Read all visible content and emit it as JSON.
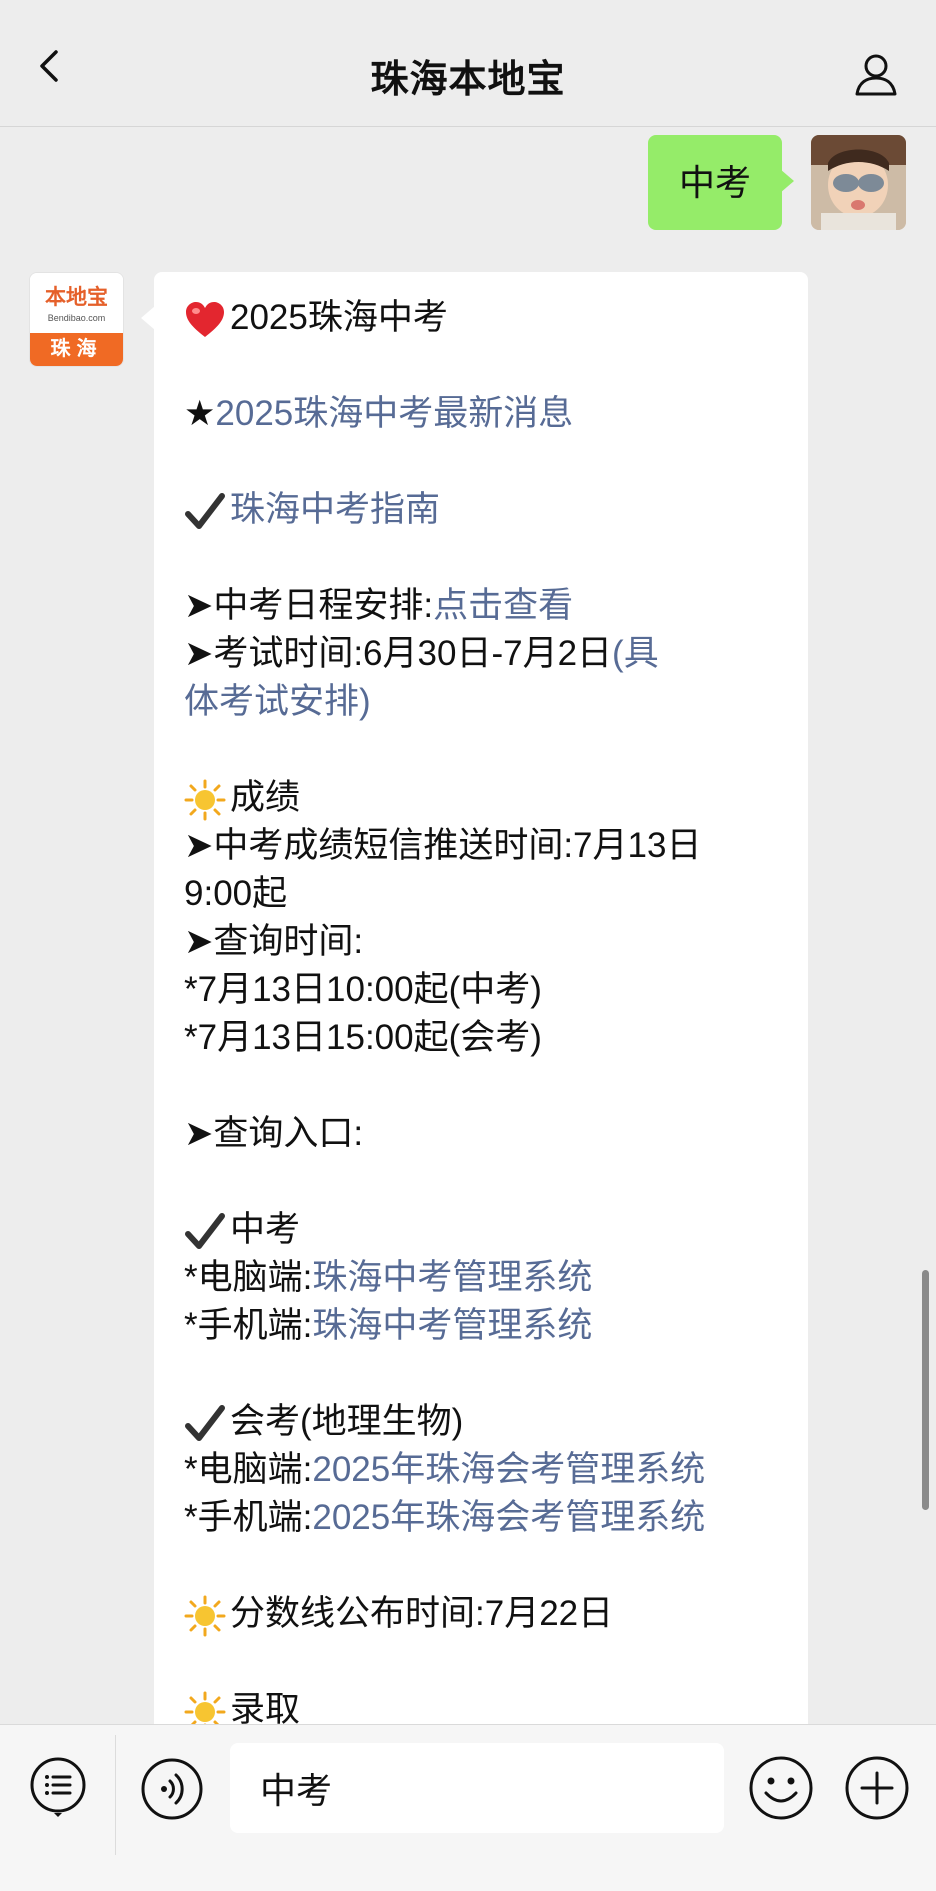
{
  "header": {
    "title": "珠海本地宝"
  },
  "user_message": {
    "text": "中考"
  },
  "bot_avatar": {
    "logo": "本地宝",
    "logo_sub": "Bendibao.com",
    "city": "珠海"
  },
  "bot_message": {
    "heading": "2025珠海中考",
    "latest_news_link": "2025珠海中考最新消息",
    "guide_link": "珠海中考指南",
    "schedule_label": "➤中考日程安排:",
    "schedule_link": "点击查看",
    "exam_time_label": "➤考试时间:6月30日-7月2日",
    "exam_time_link_a": "(具",
    "exam_time_link_b": "体考试安排)",
    "scores_title": "成绩",
    "sms_line_a": "➤中考成绩短信推送时间:7月13日",
    "sms_line_b": "9:00起",
    "query_time_label": "➤查询时间:",
    "query_time_1": "*7月13日10:00起(中考)",
    "query_time_2": "*7月13日15:00起(会考)",
    "query_entry_label": "➤查询入口:",
    "zhongkao_title": "中考",
    "pc_label": "*电脑端:",
    "mobile_label": "*手机端:",
    "zhongkao_pc_link": "珠海中考管理系统",
    "zhongkao_mobile_link": "珠海中考管理系统",
    "huikao_title": "会考(地理生物)",
    "huikao_pc_link": "2025年珠海会考管理系统",
    "huikao_mobile_link": "2025年珠海会考管理系统",
    "score_line_text": "分数线公布时间:7月22日",
    "admission_title": "录取"
  },
  "input_bar": {
    "value": "中考"
  },
  "colors": {
    "link": "#576b95",
    "user_bubble": "#95ec69",
    "brand_orange": "#f06a24"
  }
}
